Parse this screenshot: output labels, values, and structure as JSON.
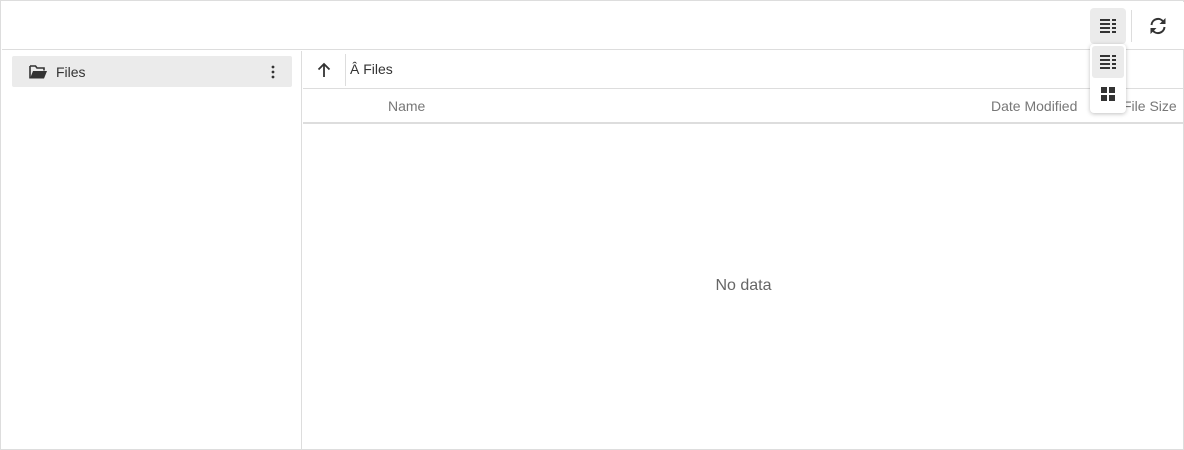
{
  "toolbar": {
    "view_icon": "details-view-icon",
    "refresh_icon": "refresh-icon"
  },
  "tree": {
    "items": [
      {
        "label": "Files",
        "icon": "folder-open-icon",
        "menu_icon": "more-vertical-icon"
      }
    ]
  },
  "breadcrumb": {
    "up_icon": "arrow-up-icon",
    "path": "Â Files"
  },
  "columns": {
    "name": "Name",
    "date_modified": "Date Modified",
    "file_size": "File Size"
  },
  "empty_message": "No data",
  "view_menu": {
    "items": [
      {
        "icon": "details-view-icon",
        "selected": true
      },
      {
        "icon": "thumbnails-view-icon",
        "selected": false
      }
    ]
  }
}
